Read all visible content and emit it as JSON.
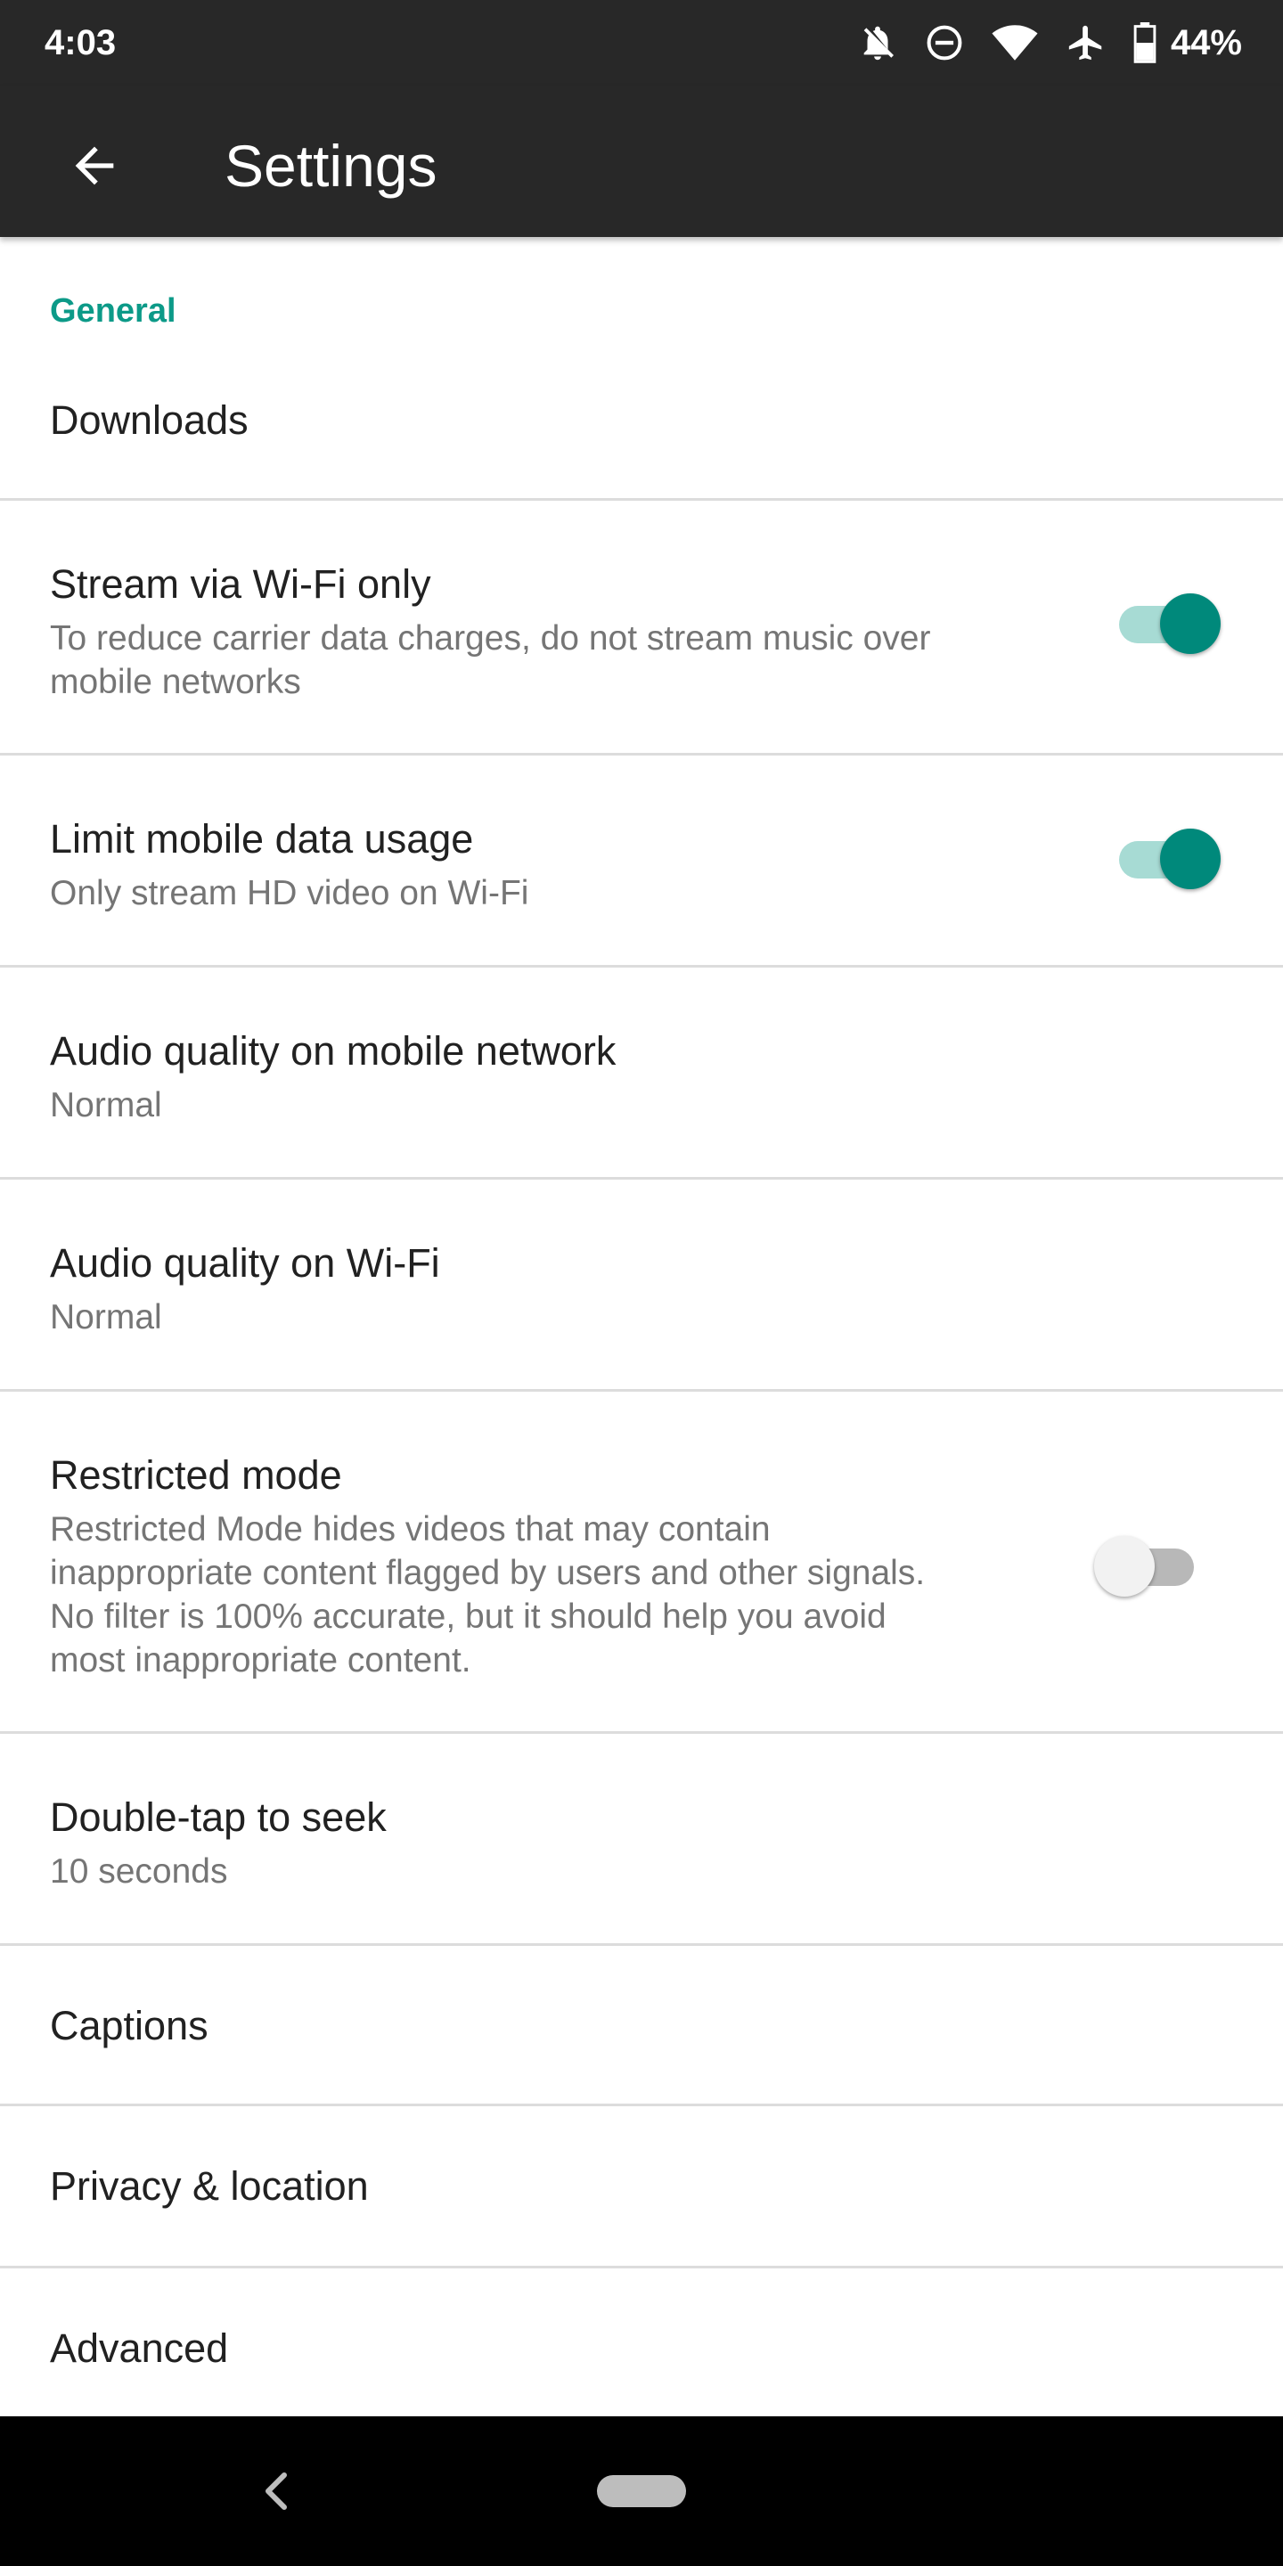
{
  "status_bar": {
    "time": "4:03",
    "battery_percent": "44%",
    "icons": [
      "notifications-off-icon",
      "do-not-disturb-icon",
      "wifi-icon",
      "airplane-mode-icon",
      "battery-icon"
    ]
  },
  "app_bar": {
    "back_icon": "arrow-back-icon",
    "title": "Settings"
  },
  "settings": {
    "section_header": "General",
    "items": [
      {
        "title": "Downloads"
      },
      {
        "title": "Stream via Wi-Fi only",
        "subtitle_lines": [
          "To reduce carrier data charges, do not stream music over",
          "mobile networks"
        ],
        "toggle": true
      },
      {
        "title": "Limit mobile data usage",
        "subtitle_lines": [
          "Only stream HD video on Wi-Fi"
        ],
        "toggle": true
      },
      {
        "title": "Audio quality on mobile network",
        "subtitle_lines": [
          "Normal"
        ]
      },
      {
        "title": "Audio quality on Wi-Fi",
        "subtitle_lines": [
          "Normal"
        ]
      },
      {
        "title": "Restricted mode",
        "subtitle_lines": [
          "Restricted Mode hides videos that may contain",
          "inappropriate content flagged by users and other signals.",
          "No filter is 100% accurate, but it should help you avoid",
          "most inappropriate content."
        ],
        "toggle": false
      },
      {
        "title": "Double-tap to seek",
        "subtitle_lines": [
          "10 seconds"
        ]
      },
      {
        "title": "Captions"
      },
      {
        "title": "Privacy & location"
      },
      {
        "title": "Advanced"
      }
    ]
  },
  "colors": {
    "accent": "#00897b",
    "section_header": "#0c9a88",
    "toolbar": "#282828"
  },
  "nav_bar": {
    "back_icon": "nav-back-chevron-icon",
    "home_icon": "nav-home-pill-icon"
  }
}
